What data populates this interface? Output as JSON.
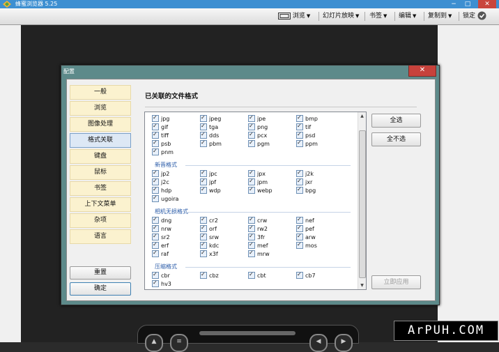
{
  "app": {
    "title": "蜂蜜浏览器 5.25"
  },
  "window_controls": {
    "minimize": "−",
    "maximize": "□",
    "close": "✕"
  },
  "toolbar": {
    "browse": "浏览",
    "slideshow": "幻灯片放映",
    "bookmark": "书签",
    "edit": "编辑",
    "copy_to": "复制到",
    "lock": "锁定"
  },
  "dialog": {
    "title": "配置",
    "close": "✕",
    "nav": [
      "一般",
      "浏览",
      "图像处理",
      "格式关联",
      "键盘",
      "鼠标",
      "书签",
      "上下文菜单",
      "杂项",
      "语言"
    ],
    "active_nav": "格式关联",
    "reset_label": "重置",
    "ok_label": "确定",
    "section_title": "已关联的文件格式",
    "select_all": "全选",
    "select_none": "全不选",
    "apply": "立即应用",
    "groups": [
      {
        "title": "",
        "items": [
          "jpg",
          "jpeg",
          "jpe",
          "bmp",
          "gif",
          "tga",
          "png",
          "tif",
          "tiff",
          "dds",
          "pcx",
          "psd",
          "psb",
          "pbm",
          "pgm",
          "ppm",
          "pnm"
        ]
      },
      {
        "title": "新晋格式",
        "items": [
          "jp2",
          "jpc",
          "jpx",
          "j2k",
          "j2c",
          "jpf",
          "jpm",
          "jxr",
          "hdp",
          "wdp",
          "webp",
          "bpg",
          "ugoira"
        ]
      },
      {
        "title": "相机无损格式",
        "items": [
          "dng",
          "cr2",
          "crw",
          "nef",
          "nrw",
          "orf",
          "rw2",
          "pef",
          "sr2",
          "srw",
          "3fr",
          "arw",
          "erf",
          "kdc",
          "mef",
          "mos",
          "raf",
          "x3f",
          "mrw"
        ]
      },
      {
        "title": "压缩格式",
        "items": [
          "cbr",
          "cbz",
          "cbt",
          "cb7",
          "hv3"
        ]
      }
    ]
  },
  "watermark": "ArPUH.COM"
}
